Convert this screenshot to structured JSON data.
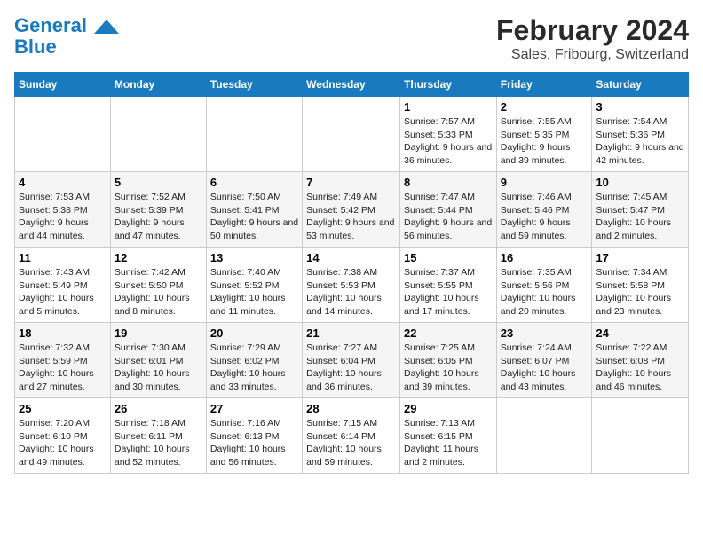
{
  "header": {
    "logo_line1": "General",
    "logo_line2": "Blue",
    "month": "February 2024",
    "location": "Sales, Fribourg, Switzerland"
  },
  "weekdays": [
    "Sunday",
    "Monday",
    "Tuesday",
    "Wednesday",
    "Thursday",
    "Friday",
    "Saturday"
  ],
  "weeks": [
    [
      {
        "day": "",
        "info": ""
      },
      {
        "day": "",
        "info": ""
      },
      {
        "day": "",
        "info": ""
      },
      {
        "day": "",
        "info": ""
      },
      {
        "day": "1",
        "info": "Sunrise: 7:57 AM\nSunset: 5:33 PM\nDaylight: 9 hours and 36 minutes."
      },
      {
        "day": "2",
        "info": "Sunrise: 7:55 AM\nSunset: 5:35 PM\nDaylight: 9 hours and 39 minutes."
      },
      {
        "day": "3",
        "info": "Sunrise: 7:54 AM\nSunset: 5:36 PM\nDaylight: 9 hours and 42 minutes."
      }
    ],
    [
      {
        "day": "4",
        "info": "Sunrise: 7:53 AM\nSunset: 5:38 PM\nDaylight: 9 hours and 44 minutes."
      },
      {
        "day": "5",
        "info": "Sunrise: 7:52 AM\nSunset: 5:39 PM\nDaylight: 9 hours and 47 minutes."
      },
      {
        "day": "6",
        "info": "Sunrise: 7:50 AM\nSunset: 5:41 PM\nDaylight: 9 hours and 50 minutes."
      },
      {
        "day": "7",
        "info": "Sunrise: 7:49 AM\nSunset: 5:42 PM\nDaylight: 9 hours and 53 minutes."
      },
      {
        "day": "8",
        "info": "Sunrise: 7:47 AM\nSunset: 5:44 PM\nDaylight: 9 hours and 56 minutes."
      },
      {
        "day": "9",
        "info": "Sunrise: 7:46 AM\nSunset: 5:46 PM\nDaylight: 9 hours and 59 minutes."
      },
      {
        "day": "10",
        "info": "Sunrise: 7:45 AM\nSunset: 5:47 PM\nDaylight: 10 hours and 2 minutes."
      }
    ],
    [
      {
        "day": "11",
        "info": "Sunrise: 7:43 AM\nSunset: 5:49 PM\nDaylight: 10 hours and 5 minutes."
      },
      {
        "day": "12",
        "info": "Sunrise: 7:42 AM\nSunset: 5:50 PM\nDaylight: 10 hours and 8 minutes."
      },
      {
        "day": "13",
        "info": "Sunrise: 7:40 AM\nSunset: 5:52 PM\nDaylight: 10 hours and 11 minutes."
      },
      {
        "day": "14",
        "info": "Sunrise: 7:38 AM\nSunset: 5:53 PM\nDaylight: 10 hours and 14 minutes."
      },
      {
        "day": "15",
        "info": "Sunrise: 7:37 AM\nSunset: 5:55 PM\nDaylight: 10 hours and 17 minutes."
      },
      {
        "day": "16",
        "info": "Sunrise: 7:35 AM\nSunset: 5:56 PM\nDaylight: 10 hours and 20 minutes."
      },
      {
        "day": "17",
        "info": "Sunrise: 7:34 AM\nSunset: 5:58 PM\nDaylight: 10 hours and 23 minutes."
      }
    ],
    [
      {
        "day": "18",
        "info": "Sunrise: 7:32 AM\nSunset: 5:59 PM\nDaylight: 10 hours and 27 minutes."
      },
      {
        "day": "19",
        "info": "Sunrise: 7:30 AM\nSunset: 6:01 PM\nDaylight: 10 hours and 30 minutes."
      },
      {
        "day": "20",
        "info": "Sunrise: 7:29 AM\nSunset: 6:02 PM\nDaylight: 10 hours and 33 minutes."
      },
      {
        "day": "21",
        "info": "Sunrise: 7:27 AM\nSunset: 6:04 PM\nDaylight: 10 hours and 36 minutes."
      },
      {
        "day": "22",
        "info": "Sunrise: 7:25 AM\nSunset: 6:05 PM\nDaylight: 10 hours and 39 minutes."
      },
      {
        "day": "23",
        "info": "Sunrise: 7:24 AM\nSunset: 6:07 PM\nDaylight: 10 hours and 43 minutes."
      },
      {
        "day": "24",
        "info": "Sunrise: 7:22 AM\nSunset: 6:08 PM\nDaylight: 10 hours and 46 minutes."
      }
    ],
    [
      {
        "day": "25",
        "info": "Sunrise: 7:20 AM\nSunset: 6:10 PM\nDaylight: 10 hours and 49 minutes."
      },
      {
        "day": "26",
        "info": "Sunrise: 7:18 AM\nSunset: 6:11 PM\nDaylight: 10 hours and 52 minutes."
      },
      {
        "day": "27",
        "info": "Sunrise: 7:16 AM\nSunset: 6:13 PM\nDaylight: 10 hours and 56 minutes."
      },
      {
        "day": "28",
        "info": "Sunrise: 7:15 AM\nSunset: 6:14 PM\nDaylight: 10 hours and 59 minutes."
      },
      {
        "day": "29",
        "info": "Sunrise: 7:13 AM\nSunset: 6:15 PM\nDaylight: 11 hours and 2 minutes."
      },
      {
        "day": "",
        "info": ""
      },
      {
        "day": "",
        "info": ""
      }
    ]
  ]
}
